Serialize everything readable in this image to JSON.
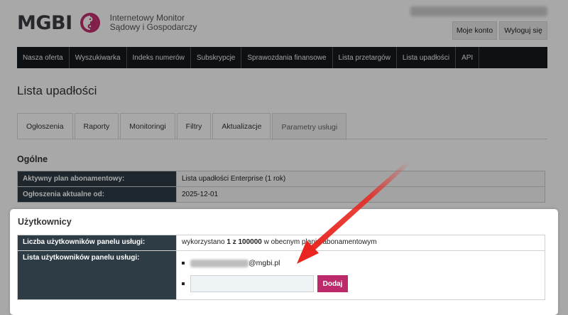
{
  "header": {
    "logo_text": "MGBI",
    "tagline_line1": "Internetowy Monitor",
    "tagline_line2": "Sądowy i Gospodarczy",
    "user_email_hidden": "",
    "my_account_label": "Moje konto",
    "logout_label": "Wyloguj się",
    "brand_color": "#c2306f"
  },
  "nav": {
    "items": [
      {
        "label": "Nasza oferta"
      },
      {
        "label": "Wyszukiwarka"
      },
      {
        "label": "Indeks numerów"
      },
      {
        "label": "Subskrypcje"
      },
      {
        "label": "Sprawozdania finansowe"
      },
      {
        "label": "Lista przetargów"
      },
      {
        "label": "Lista upadłości"
      },
      {
        "label": "API"
      }
    ]
  },
  "page": {
    "title": "Lista upadłości"
  },
  "tabs": [
    {
      "label": "Ogłoszenia"
    },
    {
      "label": "Raporty"
    },
    {
      "label": "Monitoringi"
    },
    {
      "label": "Filtry"
    },
    {
      "label": "Aktualizacje"
    },
    {
      "label": "Parametry usługi",
      "active": true
    }
  ],
  "general": {
    "title": "Ogólne",
    "rows": [
      {
        "key": "Aktywny plan abonamentowy:",
        "value": "Lista upadłości Enterprise (1 rok)"
      },
      {
        "key": "Ogłoszenia aktualne od:",
        "value": "2025-12-01"
      }
    ]
  },
  "users": {
    "title": "Użytkownicy",
    "count_key": "Liczba użytkowników panelu usługi:",
    "count_prefix": "wykorzystano ",
    "count_bold": "1 z 100000",
    "count_suffix": " w obecnym planie abonamentowym",
    "list_key": "Lista użytkowników panelu usługi:",
    "user_domain": "@mgbi.pl",
    "new_user_placeholder": "",
    "add_label": "Dodaj",
    "add_button_color": "#bd2a6b"
  },
  "annotation": {
    "arrow_color": "#e8251f"
  }
}
